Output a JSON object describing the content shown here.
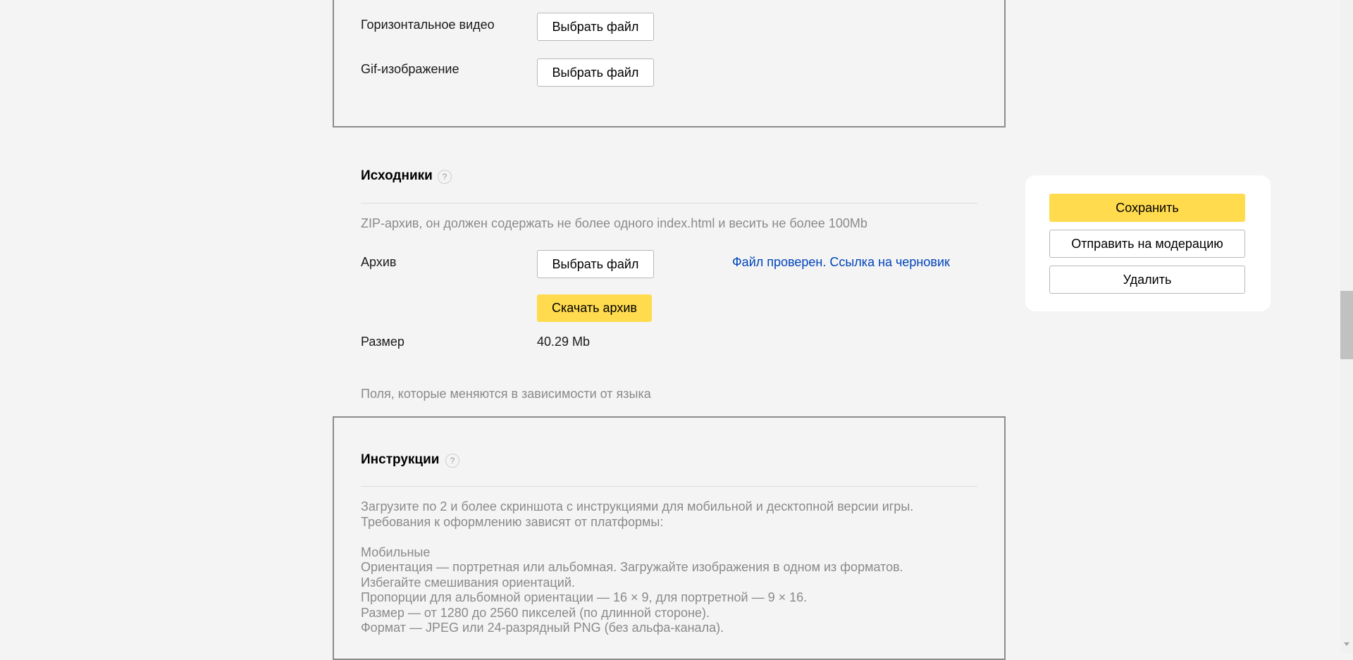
{
  "media": {
    "horizontal_video_label": "Горизонтальное видео",
    "horizontal_video_button": "Выбрать файл",
    "gif_label": "Gif-изображение",
    "gif_button": "Выбрать файл"
  },
  "sources": {
    "title": "Исходники",
    "help": "?",
    "description": "ZIP-архив, он должен содержать не более одного index.html и весить не более 100Mb",
    "archive_label": "Архив",
    "archive_button": "Выбрать файл",
    "status_link": "Файл проверен. Ссылка на черновик",
    "download_button": "Скачать архив",
    "size_label": "Размер",
    "size_value": "40.29 Mb"
  },
  "language_note": "Поля, которые меняются в зависимости от языка",
  "instructions": {
    "title": "Инструкции",
    "help": "?",
    "lines": [
      "Загрузите по 2 и более скриншота с инструкциями для мобильной и десктопной версии игры.",
      "Требования к оформлению зависят от платформы:",
      "",
      "Мобильные",
      "Ориентация — портретная или альбомная. Загружайте изображения в одном из форматов.",
      "Избегайте смешивания ориентаций.",
      "Пропорции для альбомной ориентации — 16 × 9, для портретной — 9 × 16.",
      "Размер — от 1280 до 2560 пикселей (по длинной стороне).",
      "Формат — JPEG или 24-разрядный PNG (без альфа-канала)."
    ]
  },
  "sidebar": {
    "save_button": "Сохранить",
    "moderation_button": "Отправить на модерацию",
    "delete_button": "Удалить"
  },
  "colors": {
    "accent_yellow": "#ffdb4d",
    "link_blue": "#0044bb",
    "background": "#f4f4f4"
  }
}
